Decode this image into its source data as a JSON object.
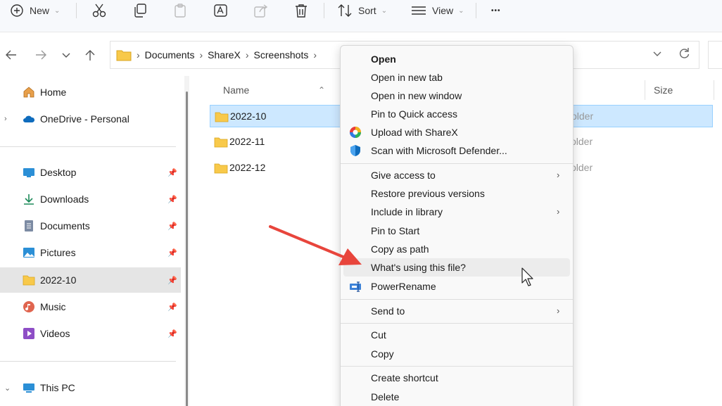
{
  "command_bar": {
    "new_label": "New",
    "sort_label": "Sort",
    "view_label": "View",
    "more_label": "•••"
  },
  "address_bar": {
    "crumbs": [
      "Documents",
      "ShareX",
      "Screenshots"
    ]
  },
  "sidebar": {
    "items": [
      {
        "label": "Home",
        "icon": "home-icon"
      },
      {
        "label": "OneDrive - Personal",
        "icon": "onedrive-cloud-icon"
      },
      {
        "label": "Desktop",
        "icon": "desktop-icon",
        "pinned": true
      },
      {
        "label": "Downloads",
        "icon": "download-arrow-icon",
        "pinned": true
      },
      {
        "label": "Documents",
        "icon": "document-icon",
        "pinned": true
      },
      {
        "label": "Pictures",
        "icon": "pictures-icon",
        "pinned": true
      },
      {
        "label": "2022-10",
        "icon": "folder-icon",
        "pinned": true,
        "selected": true
      },
      {
        "label": "Music",
        "icon": "music-icon",
        "pinned": true
      },
      {
        "label": "Videos",
        "icon": "videos-icon",
        "pinned": true
      },
      {
        "label": "This PC",
        "icon": "this-pc-icon"
      }
    ]
  },
  "file_list": {
    "columns": {
      "name": "Name",
      "size": "Size"
    },
    "rows": [
      {
        "name": "2022-10",
        "type": "older",
        "selected": true
      },
      {
        "name": "2022-11",
        "type": "older"
      },
      {
        "name": "2022-12",
        "type": "older"
      }
    ]
  },
  "context_menu": {
    "items": [
      {
        "label": "Open",
        "bold": true
      },
      {
        "label": "Open in new tab"
      },
      {
        "label": "Open in new window"
      },
      {
        "label": "Pin to Quick access"
      },
      {
        "label": "Upload with ShareX",
        "icon": "sharex-icon"
      },
      {
        "label": "Scan with Microsoft Defender...",
        "icon": "defender-shield-icon"
      },
      {
        "label": "Give access to",
        "submenu": true
      },
      {
        "label": "Restore previous versions"
      },
      {
        "label": "Include in library",
        "submenu": true
      },
      {
        "label": "Pin to Start"
      },
      {
        "label": "Copy as path"
      },
      {
        "label": "What's using this file?",
        "hover": true
      },
      {
        "label": "PowerRename",
        "icon": "powerrename-icon"
      },
      {
        "label": "Send to",
        "submenu": true
      },
      {
        "label": "Cut"
      },
      {
        "label": "Copy"
      },
      {
        "label": "Create shortcut"
      },
      {
        "label": "Delete"
      }
    ]
  },
  "colors": {
    "accent_arrow": "#e8453c",
    "folder": "#f8c94a",
    "selection": "#cde8ff"
  }
}
